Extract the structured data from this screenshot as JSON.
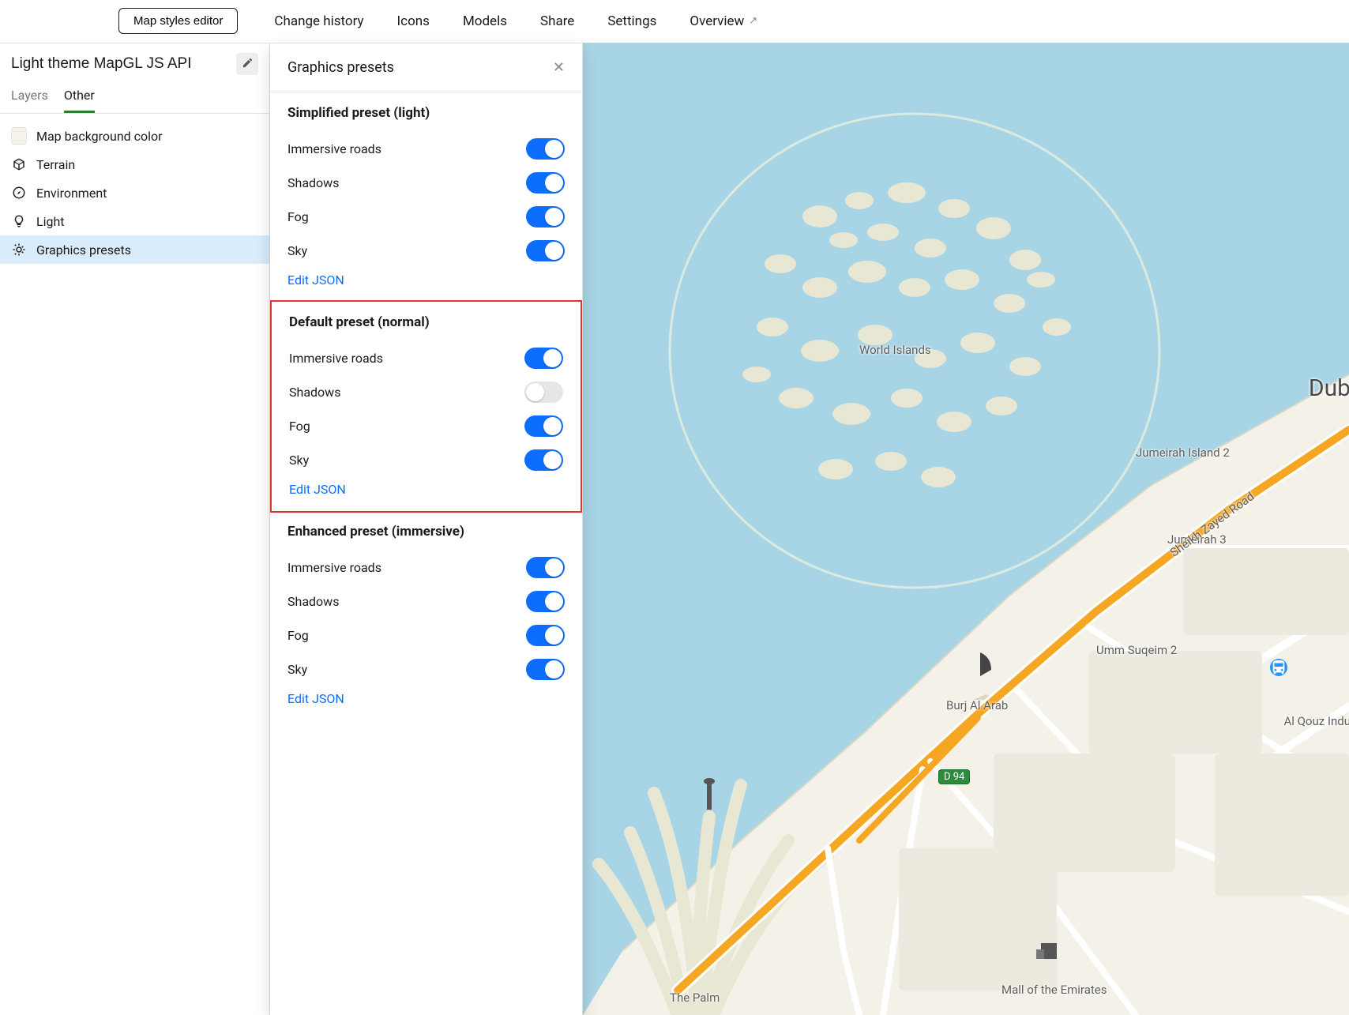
{
  "topbar": {
    "editor_button": "Map styles editor",
    "links": [
      "Change history",
      "Icons",
      "Models",
      "Share",
      "Settings",
      "Overview"
    ]
  },
  "sidebar": {
    "style_name": "Light theme MapGL JS API",
    "tabs": {
      "layers": "Layers",
      "other": "Other",
      "active": "other"
    },
    "items": [
      {
        "icon": "swatch",
        "label": "Map background color"
      },
      {
        "icon": "terrain",
        "label": "Terrain"
      },
      {
        "icon": "env",
        "label": "Environment"
      },
      {
        "icon": "light",
        "label": "Light"
      },
      {
        "icon": "presets",
        "label": "Graphics presets",
        "selected": true
      }
    ]
  },
  "panel": {
    "title": "Graphics presets",
    "edit_json_label": "Edit JSON",
    "presets": [
      {
        "title": "Simplified preset (light)",
        "highlight": false,
        "options": [
          {
            "label": "Immersive roads",
            "on": true
          },
          {
            "label": "Shadows",
            "on": true
          },
          {
            "label": "Fog",
            "on": true
          },
          {
            "label": "Sky",
            "on": true
          }
        ]
      },
      {
        "title": "Default preset (normal)",
        "highlight": true,
        "options": [
          {
            "label": "Immersive roads",
            "on": true
          },
          {
            "label": "Shadows",
            "on": false
          },
          {
            "label": "Fog",
            "on": true
          },
          {
            "label": "Sky",
            "on": true
          }
        ]
      },
      {
        "title": "Enhanced preset (immersive)",
        "highlight": false,
        "options": [
          {
            "label": "Immersive roads",
            "on": true
          },
          {
            "label": "Shadows",
            "on": true
          },
          {
            "label": "Fog",
            "on": true
          },
          {
            "label": "Sky",
            "on": true
          }
        ]
      }
    ]
  },
  "map": {
    "labels": {
      "world_islands": "World Islands",
      "dubai": "Dub",
      "jumeirah_island_2": "Jumeirah Island 2",
      "jumeirah_3": "Jumeirah 3",
      "umm_suqeim_2": "Umm Suqeim 2",
      "burj_al_arab": "Burj Al Arab",
      "al_qouz": "Al Qouz Indu",
      "the_palm": "The Palm",
      "mall": "Mall of the Emirates",
      "road_name": "Sheikh Zayed Road",
      "shield": "D 94"
    }
  }
}
